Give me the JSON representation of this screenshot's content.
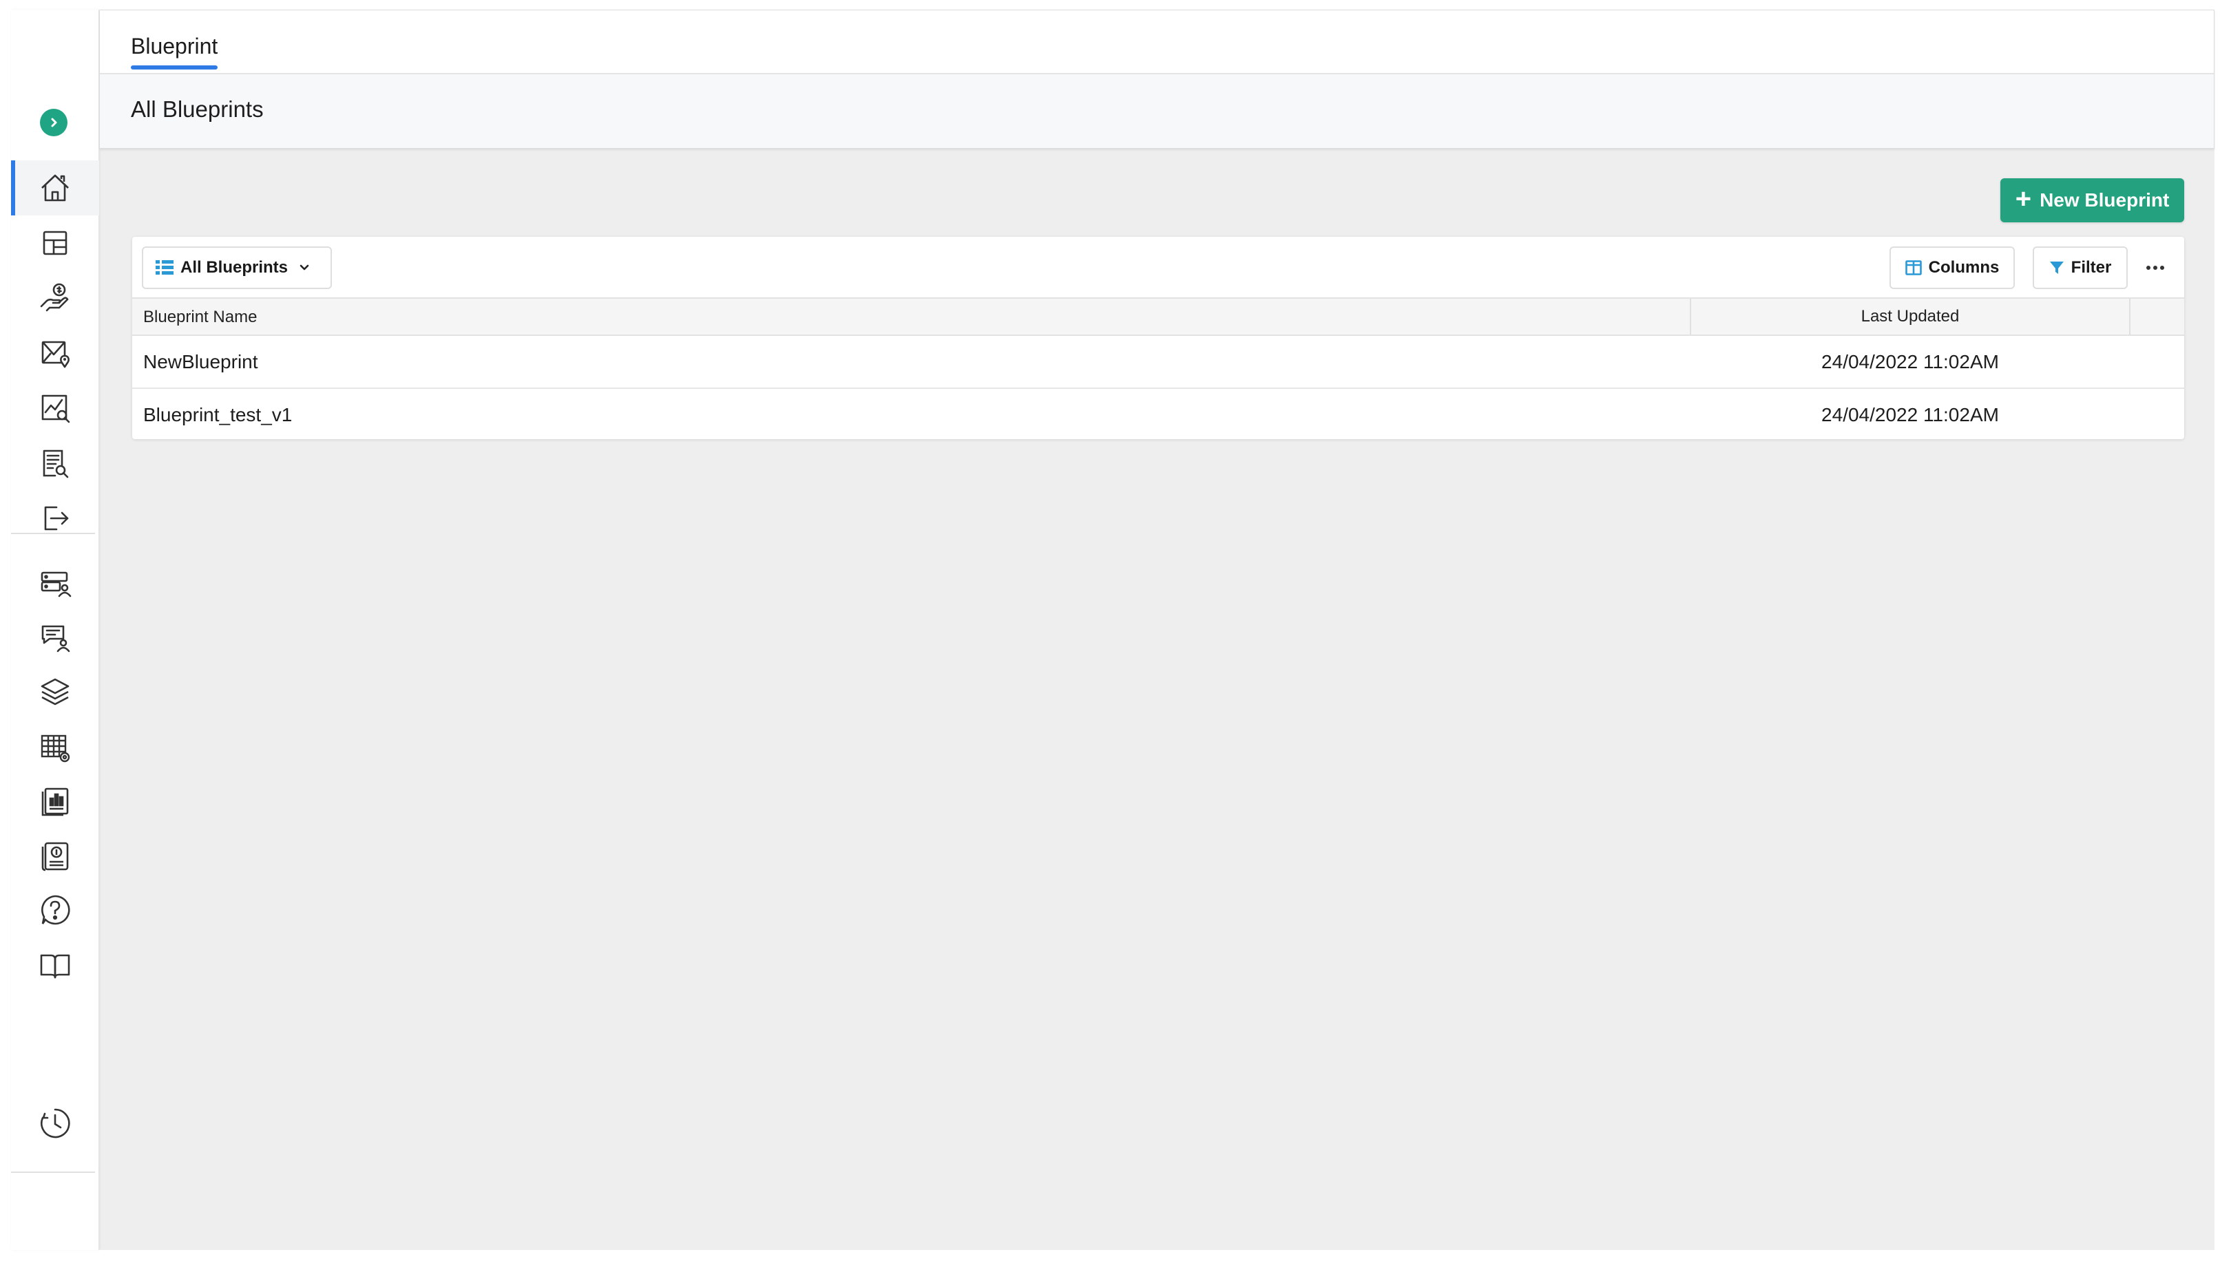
{
  "colors": {
    "accent_green": "#24a27f",
    "active_blue": "#2f7be5"
  },
  "sidebar": {
    "items": [
      {
        "icon": "home-icon"
      },
      {
        "icon": "layout-icon"
      },
      {
        "icon": "hand-money-icon"
      },
      {
        "icon": "mail-location-icon"
      },
      {
        "icon": "chart-search-icon"
      },
      {
        "icon": "document-search-icon"
      },
      {
        "icon": "logout-icon"
      },
      {
        "icon": "server-user-icon"
      },
      {
        "icon": "chat-user-icon"
      },
      {
        "icon": "layers-icon"
      },
      {
        "icon": "table-settings-icon"
      },
      {
        "icon": "report-chart-icon"
      },
      {
        "icon": "book-money-icon"
      },
      {
        "icon": "help-icon"
      },
      {
        "icon": "open-book-icon"
      },
      {
        "icon": "clock-icon"
      }
    ]
  },
  "header": {
    "tab_label": "Blueprint",
    "subtitle": "All Blueprints"
  },
  "actions": {
    "new_button": "New Blueprint"
  },
  "toolbar": {
    "view_label": "All Blueprints",
    "columns_label": "Columns",
    "filter_label": "Filter"
  },
  "table": {
    "headers": [
      "Blueprint Name",
      "Last Updated"
    ],
    "rows": [
      {
        "name": "NewBlueprint",
        "updated": "24/04/2022 11:02AM"
      },
      {
        "name": "Blueprint_test_v1",
        "updated": "24/04/2022 11:02AM"
      }
    ]
  }
}
